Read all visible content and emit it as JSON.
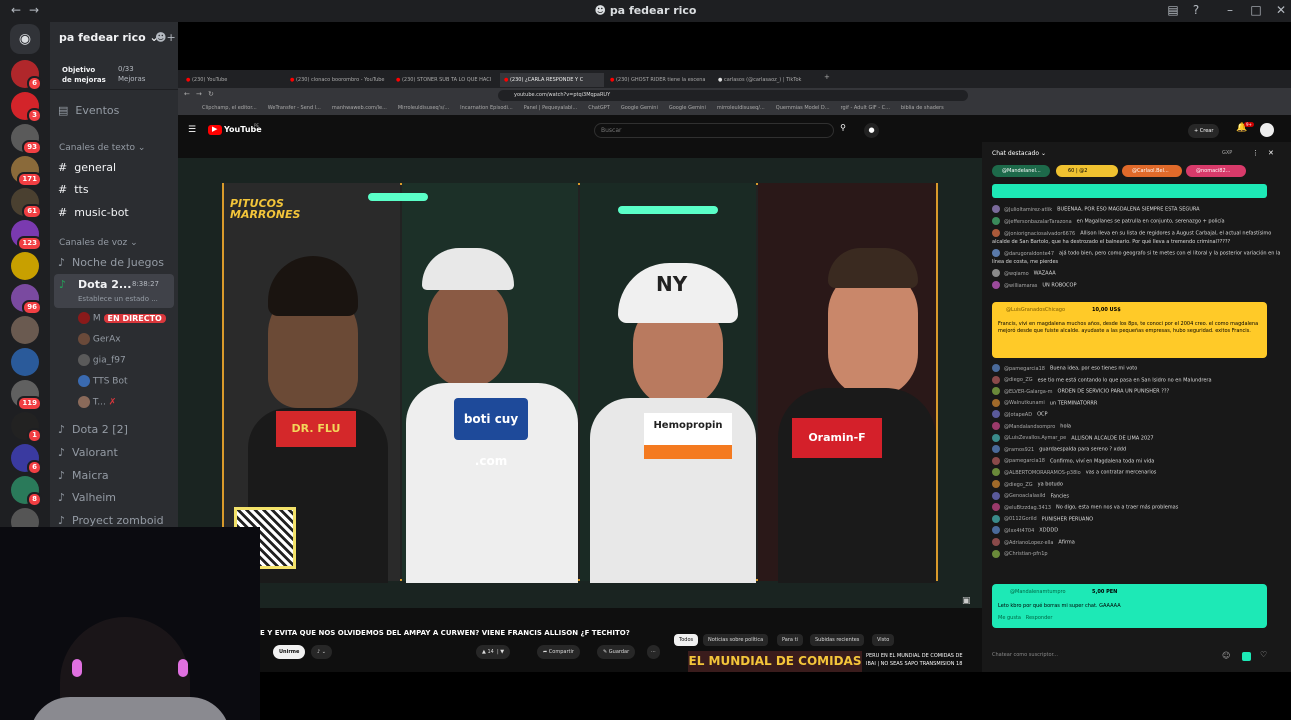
{
  "window": {
    "title": "pa fedear rico"
  },
  "server": {
    "name": "pa fedear rico",
    "boost_title": "Objetivo de mejoras",
    "boost_count": "0/33",
    "boost_unit": "Mejoras",
    "events": "Eventos"
  },
  "servers": [
    {
      "color": "#b0272b",
      "badge": "6"
    },
    {
      "color": "#d3242a",
      "badge": "3"
    },
    {
      "color": "#5a5a5a",
      "badge": "93"
    },
    {
      "color": "#8a6a3a",
      "badge": "171"
    },
    {
      "color": "#4a4030",
      "badge": "61"
    },
    {
      "color": "#7a3ab0",
      "badge": "123"
    },
    {
      "color": "#c8a000",
      "badge": ""
    },
    {
      "color": "#7a4aa0",
      "badge": "96"
    },
    {
      "color": "#6a5a50",
      "badge": ""
    },
    {
      "color": "#2a5a9a",
      "badge": ""
    },
    {
      "color": "#606060",
      "badge": "119"
    },
    {
      "color": "#222",
      "badge": "1"
    },
    {
      "color": "#3a3aa0",
      "badge": "6"
    },
    {
      "color": "#2a7a5a",
      "badge": "8"
    },
    {
      "color": "#555",
      "badge": ""
    }
  ],
  "text_category": "Canales de texto",
  "text_channels": [
    "general",
    "tts",
    "music-bot"
  ],
  "voice_category": "Canales de voz",
  "voice_channels": {
    "noche": "Noche de Juegos",
    "dota2": "Dota 2...",
    "dota2_time": "8:38:27",
    "dota2_status": "Establece un estado ...",
    "live": "EN DIRECTO",
    "users": [
      "M",
      "GerAx",
      "gia_f97",
      "TTS Bot",
      "T..."
    ],
    "more": [
      "Dota 2 [2]",
      "Valorant",
      "Maicra",
      "Valheim",
      "Proyect zomboid"
    ]
  },
  "browser": {
    "tabs": [
      "(230) YouTube",
      "(230) clonaco boorombro - YouTube",
      "(230) STONER SUB TA LO QUE HACI",
      "(230) ¿CARLA RESPONDE Y C",
      "(230) GHOST RIDER tiene la escena",
      "carlasos (@carlasaoz_) | TikTok"
    ],
    "url": "youtube.com/watch?v=ptqi3MqpaRUY",
    "bookmarks": [
      "Clipchamp, el editor...",
      "WeTransfer - Send l...",
      "manhwaweb.com/le...",
      "Mirroleuldisuseq's/...",
      "Incarnation Episodi...",
      "Panel | Pequeyalabl...",
      "ChatGPT",
      "Google Gemini",
      "Google Gemini",
      "mirroleuldisuseq/...",
      "Quemmias Model D...",
      "rgif - Adult GIF - C...",
      "biblia de shaders"
    ]
  },
  "youtube": {
    "logo": "YouTube",
    "country": "PE",
    "search_placeholder": "Buscar",
    "create": "Crear",
    "notif": "9+"
  },
  "video": {
    "show_title": "PITUCOS MARRONES",
    "sponsors": [
      "DR. FLU",
      "boti cuy .com",
      "Hemopropin",
      "Oramin-F"
    ],
    "ny": "NY",
    "panel_colors": [
      "#2a2a2a",
      "#1c3028",
      "#1a2a24",
      "#2a1818"
    ]
  },
  "title_text": "E Y EVITA QUE NOS OLVIDEMOS DEL AMPAY A CURWEN? VIENE FRANCIS ALLISON ¿F TECHITO?",
  "actions": {
    "join": "Unirme",
    "likes": "14",
    "share": "Compartir",
    "save": "Guardar"
  },
  "chips": [
    "Todos",
    "Noticias sobre política",
    "Para ti",
    "Subidas recientes",
    "Visto"
  ],
  "rec_text": [
    "PERU EN EL MUNDIAL DE COMIDAS DE",
    "IBAI | NO SEAS SAPO TRANSMISION 18"
  ],
  "rec_thumb": "EL MUNDIAL DE COMIDAS",
  "chat": {
    "header": "Chat destacado",
    "top_gbp": "GXP",
    "donor_chips": [
      "@Mandelanel...",
      "60 | @2",
      "@Carlaol.Bel...",
      "@nomaci82..."
    ],
    "super": {
      "name": "@LuisGranadosChicago",
      "amount": "10,00 US$",
      "text": "Francis, vivi en magdalena muchos años, desde los 8ps, te conoci por el 2004 creo. el como magdalena mejoró desde que fuiste alcalde. ayudaste a las pequeñas empresas, hubo seguridad. exitos Francis."
    },
    "super2": {
      "name": "@Mandalenamtumpro",
      "amount": "5,00 PEN",
      "text": "Leto kbro por qué borras mi super chat. GAAAAA",
      "b1": "Me gusta",
      "b2": "Responder"
    },
    "messages_a": [
      [
        "@Julioltamirez·atlik",
        "BUEENAA, POR ESO MAGDALENA SIEMPRE ESTA SEGURA"
      ],
      [
        "@jeffersonbazalarTarazona",
        "en Magallanes se patrulla en conjunto, serenazgo + policía"
      ],
      [
        "@joniorignaciosalvador6676",
        "Allison lleva en su lista de regidores a August Carbajal, el actual nefastísimo alcalde de San Bartolo, que ha destrozado el balneario. Por qué lleva a tremendo criminal?????"
      ],
      [
        "@darugoraldonte47",
        "ajá todo bien, pero como geografo si te metes con el litoral y la posterior variación en la línea de costa, me pierdes"
      ],
      [
        "@wqiamo",
        "WAZAAA"
      ],
      [
        "@williamaras",
        "UN ROBOCOP"
      ]
    ],
    "messages_b": [
      [
        "@pamegarcia18",
        "Buena idea, por eso tienes mi voto"
      ],
      [
        "@diego_ZG",
        "ese tio me está contando lo que pasa en San Isidro no en Malundrera"
      ],
      [
        "@ELVER-Galarga-m",
        "ORDEN DE SERVICIO PARA UN PUNISHER ???"
      ],
      [
        "@Walnutkunami",
        "un TERMINATORRR"
      ],
      [
        "@JotapeAD",
        "OCP"
      ],
      [
        "@Mandalandsompro",
        "hola"
      ],
      [
        "@LuisZevallos.Aymar_pe",
        "ALLISON ALCALDE DE LIMA 2027"
      ],
      [
        "@ramos921",
        "guardaespalda para sereno ? xddd"
      ],
      [
        "@pamegarcia18",
        "Confirmo, viví en Magdalena toda mi vida"
      ],
      [
        "@ALBERTOMORARAMOS-p38lo",
        "vas a contratar mercenarios"
      ],
      [
        "@diego_ZG",
        "ya botudo"
      ],
      [
        "@Genoaclalasild",
        "Fancies"
      ],
      [
        "@eluBtzzdag.3413",
        "No digo, esta men nos va a traer más problemas"
      ],
      [
        "@0112Gorild",
        "PUNISHER PERUANO"
      ],
      [
        "@Ixx4t4704",
        "XDDDD"
      ],
      [
        "@AdrianoLopez·ella",
        "Afirma"
      ],
      [
        "@Christian-pfn1p",
        ""
      ]
    ],
    "input_placeholder": "Chatear como suscriptor..."
  }
}
